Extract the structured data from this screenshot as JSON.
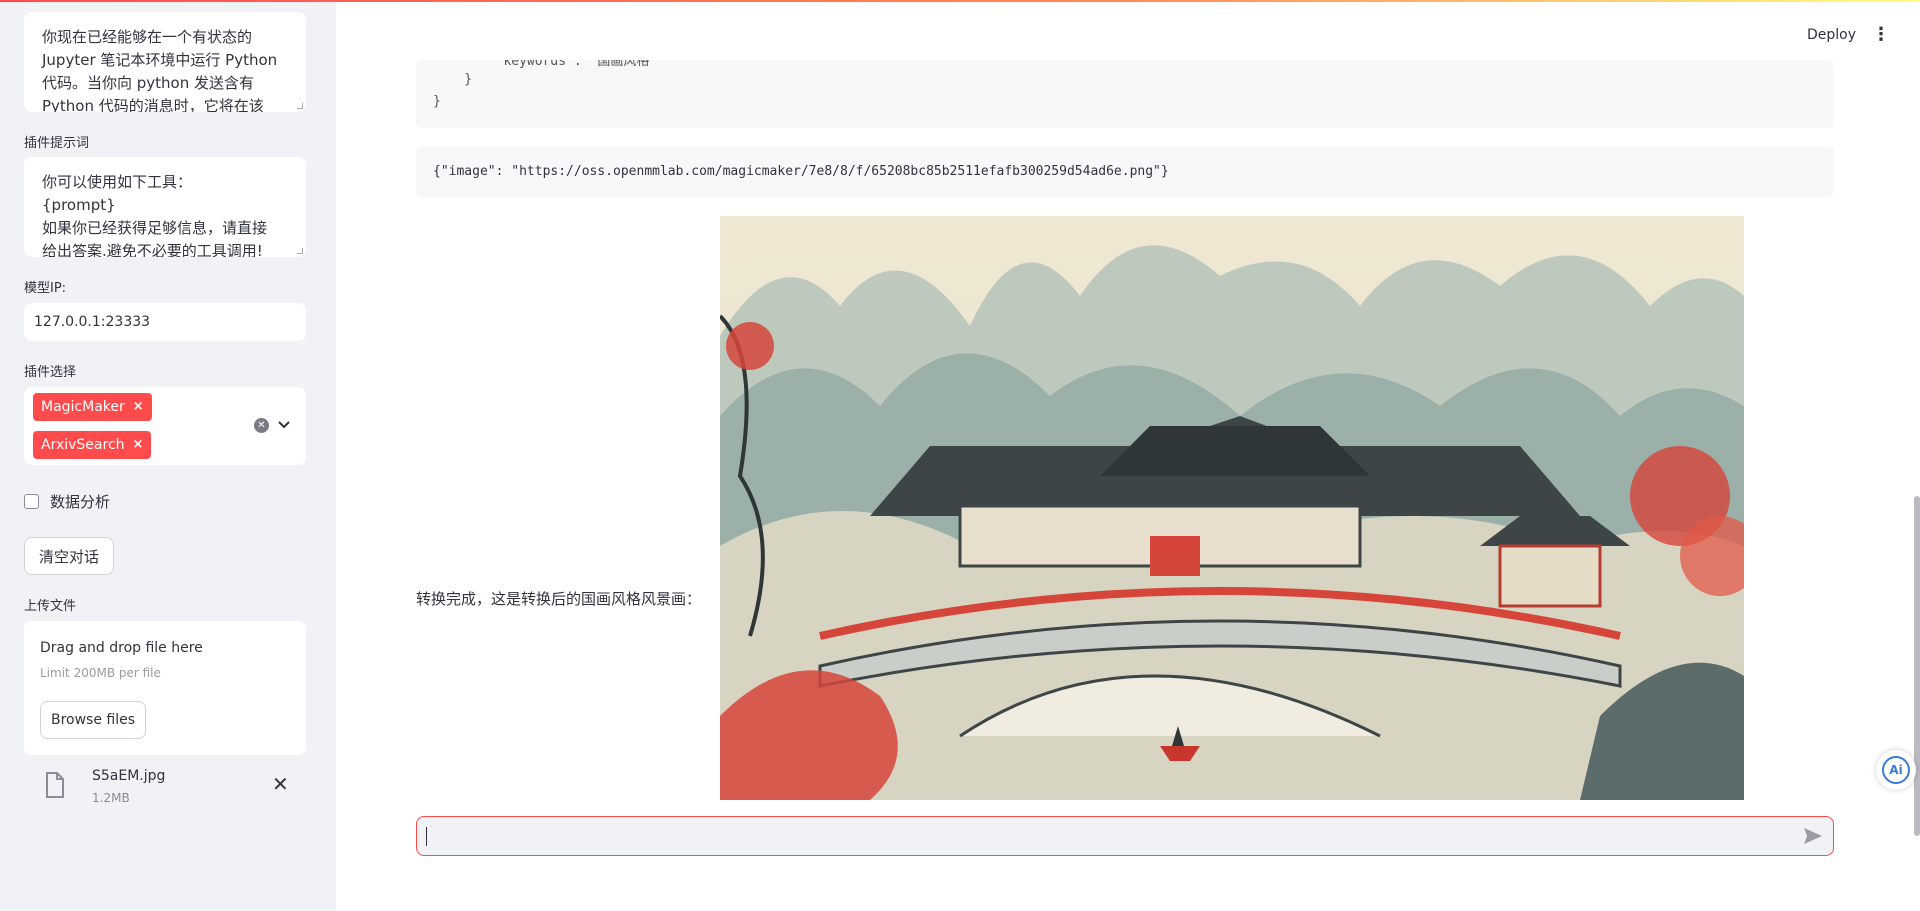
{
  "sidebar": {
    "system_prompt": {
      "lines": [
        "你现在已经能够在一个有状态的",
        "Jupyter 笔记本环境中运行 Python",
        "代码。当你向 python 发送含有",
        "Python 代码的消息时，它将在该"
      ]
    },
    "plugin_prompt": {
      "label": "插件提示词",
      "lines": [
        "你可以使用如下工具：",
        "{prompt}",
        "如果你已经获得足够信息，请直接",
        "给出答案.避免不必要的工具调用!"
      ]
    },
    "model_ip": {
      "label": "模型IP:",
      "value": "127.0.0.1:23333"
    },
    "plugin_select": {
      "label": "插件选择",
      "tags": [
        "MagicMaker",
        "ArxivSearch"
      ],
      "remove_glyph": "×"
    },
    "data_analysis": {
      "label": "数据分析",
      "checked": false
    },
    "clear_button": "清空对话",
    "upload": {
      "label": "上传文件",
      "drop_title": "Drag and drop file here",
      "limit": "Limit 200MB per file",
      "browse_button": "Browse files",
      "file": {
        "name": "S5aEM.jpg",
        "size": "1.2MB",
        "remove_glyph": "✕"
      }
    }
  },
  "header": {
    "deploy": "Deploy",
    "menu_glyph": "⋮"
  },
  "main": {
    "code_lines": [
      {
        "text": "        \"keywords\": \"国画风格\""
      },
      {
        "text": "    }"
      },
      {
        "text": "}"
      }
    ],
    "json_output": "{\"image\": \"https://oss.openmmlab.com/magicmaker/7e8/8/f/65208bc85b2511efafb300259d54ad6e.png\"}",
    "caption": "转换完成，这是转换后的国画风格风景画：",
    "chat_input_value": ""
  },
  "ai_badge": "Ai",
  "colors": {
    "accent": "#ff4b4b",
    "sidebar_bg": "#f0f2f6",
    "text": "#31333f"
  }
}
